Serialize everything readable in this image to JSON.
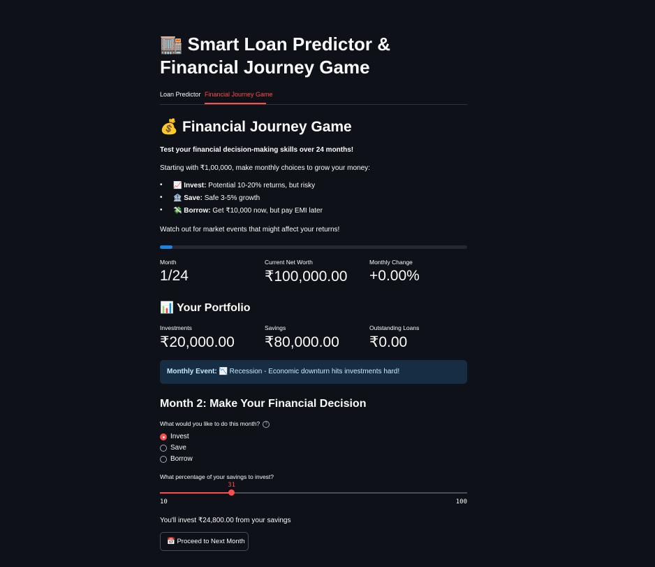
{
  "page": {
    "title_line1": "🏬 Smart Loan Predictor &",
    "title_line2": "Financial Journey Game"
  },
  "tabs": [
    {
      "label": "Loan Predictor",
      "active": false
    },
    {
      "label": "Financial Journey Game",
      "active": true
    }
  ],
  "game": {
    "heading": "💰 Financial Journey Game",
    "intro_bold": "Test your financial decision-making skills over 24 months!",
    "intro": "Starting with ₹1,00,000, make monthly choices to grow your money:",
    "options": [
      {
        "icon": "📈",
        "name": "Invest:",
        "desc": " Potential 10-20% returns, but risky"
      },
      {
        "icon": "🏦",
        "name": "Save:",
        "desc": " Safe 3-5% growth"
      },
      {
        "icon": "💸",
        "name": "Borrow:",
        "desc": " Get ₹10,000 now, but pay EMI later"
      }
    ],
    "warning": "Watch out for market events that might affect your returns!",
    "progress_fraction": 0.04,
    "metrics": {
      "month_label": "Month",
      "month_value": "1/24",
      "net_worth_label": "Current Net Worth",
      "net_worth_value": "₹100,000.00",
      "change_label": "Monthly Change",
      "change_value": "+0.00%"
    },
    "portfolio_heading": "📊 Your Portfolio",
    "portfolio": {
      "investments_label": "Investments",
      "investments_value": "₹20,000.00",
      "savings_label": "Savings",
      "savings_value": "₹80,000.00",
      "loans_label": "Outstanding Loans",
      "loans_value": "₹0.00"
    },
    "event": {
      "label": "Monthly Event:",
      "text": " 📉 Recession - Economic downturn hits investments hard!"
    },
    "decision_heading": "Month 2: Make Your Financial Decision",
    "decision_question": "What would you like to do this month?",
    "help_icon": "?",
    "choices": [
      {
        "label": "Invest",
        "selected": true
      },
      {
        "label": "Save",
        "selected": false
      },
      {
        "label": "Borrow",
        "selected": false
      }
    ],
    "slider": {
      "label": "What percentage of your savings to invest?",
      "min": 10,
      "max": 100,
      "value": 31
    },
    "invest_summary": "You'll invest ₹24,800.00 from your savings",
    "proceed_button": "📅 Proceed to Next Month"
  },
  "colors": {
    "background": "#0e1117",
    "accent": "#ff4b4b",
    "progress": "#1c83e1",
    "info_box": "#172d43"
  }
}
